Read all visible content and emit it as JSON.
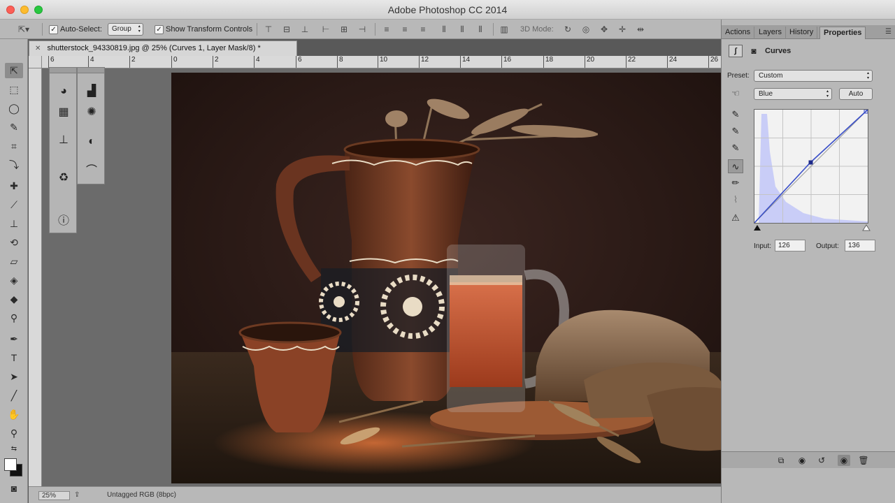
{
  "app": {
    "title": "Adobe Photoshop CC 2014"
  },
  "options_bar": {
    "auto_select_label": "Auto-Select:",
    "auto_select_value": "Group",
    "show_transform_label": "Show Transform Controls",
    "mode_3d_label": "3D Mode:"
  },
  "document": {
    "tab_title": "shutterstock_94330819.jpg @ 25% (Curves 1, Layer Mask/8) *",
    "ruler_ticks": [
      "6",
      "4",
      "2",
      "0",
      "2",
      "4",
      "6",
      "8",
      "10",
      "12",
      "14",
      "16",
      "18",
      "20",
      "22",
      "24",
      "26"
    ]
  },
  "status": {
    "zoom": "25%",
    "doc_info": "Untagged RGB (8bpc)"
  },
  "panel": {
    "tabs": [
      "Actions",
      "Layers",
      "History",
      "Properties"
    ],
    "active_tab": "Properties",
    "title": "Curves",
    "preset_label": "Preset:",
    "preset_value": "Custom",
    "channel_value": "Blue",
    "auto_label": "Auto",
    "input_label": "Input:",
    "input_value": "126",
    "output_label": "Output:",
    "output_value": "136"
  },
  "colors": {
    "curve_line": "#3a4fc9",
    "histogram": "#c9cdf7",
    "canvas_bg": "#2a1915"
  }
}
